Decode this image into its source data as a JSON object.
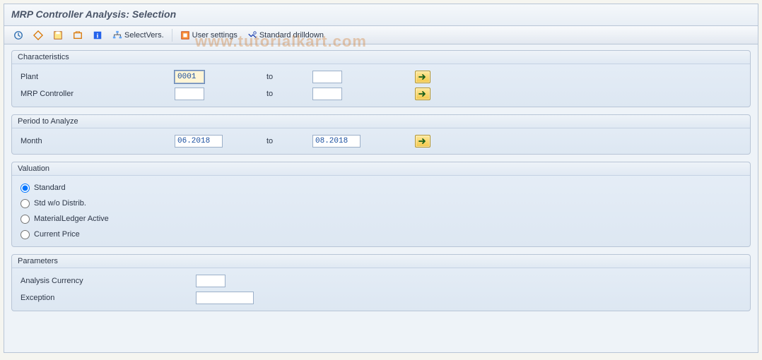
{
  "title": "MRP Controller Analysis: Selection",
  "watermark": "www.tutorialkart.com",
  "toolbar": {
    "execute": "",
    "selectvers": "SelectVers.",
    "usersettings": "User settings",
    "stddrilldown": "Standard drilldown"
  },
  "groups": {
    "characteristics": {
      "title": "Characteristics",
      "plant": {
        "label": "Plant",
        "low": "0001",
        "to": "to",
        "high": ""
      },
      "mrpctrl": {
        "label": "MRP Controller",
        "low": "",
        "to": "to",
        "high": ""
      }
    },
    "period": {
      "title": "Period to Analyze",
      "month": {
        "label": "Month",
        "low": "06.2018",
        "to": "to",
        "high": "08.2018"
      }
    },
    "valuation": {
      "title": "Valuation",
      "options": {
        "standard": "Standard",
        "stdwo": "Std w/o Distrib.",
        "mlactive": "MaterialLedger Active",
        "currprice": "Current Price"
      },
      "selected": "standard"
    },
    "parameters": {
      "title": "Parameters",
      "currency": {
        "label": "Analysis Currency",
        "value": ""
      },
      "exception": {
        "label": "Exception",
        "value": ""
      }
    }
  }
}
